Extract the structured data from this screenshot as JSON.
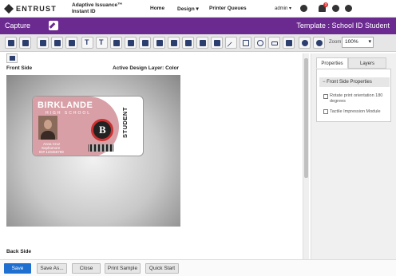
{
  "topbar": {
    "logo": "ENTRUST",
    "product_line1": "Adaptive Issuance™",
    "product_line2": "Instant ID",
    "nav_home": "Home",
    "nav_design": "Design ▾",
    "nav_printer": "Printer Queues",
    "admin": "admin ▾",
    "notification_count": "3"
  },
  "header": {
    "title": "Capture",
    "template": "Template : School ID Student"
  },
  "toolbar": {
    "zoom_label": "Zoom",
    "zoom_value": "100%"
  },
  "canvas": {
    "front_label": "Front Side",
    "layer_label": "Active Design Layer: Color",
    "back_label": "Back Side"
  },
  "card": {
    "school": "BIRKLANDE",
    "subtitle": "HIGH SCHOOL",
    "name": "Anna Cruz",
    "grade": "Sophomore",
    "id": "ID# 123456789",
    "student": "STUDENT"
  },
  "panel": {
    "tab_properties": "Properties",
    "tab_layers": "Layers",
    "section": "− Front Side Properties",
    "opt1": "Rotate print orientation 180 degrees",
    "opt2": "Tactile Impression Module"
  },
  "footer": {
    "save": "Save",
    "save_as": "Save As...",
    "close": "Close",
    "print_sample": "Print Sample",
    "quick_start": "Quick Start"
  }
}
